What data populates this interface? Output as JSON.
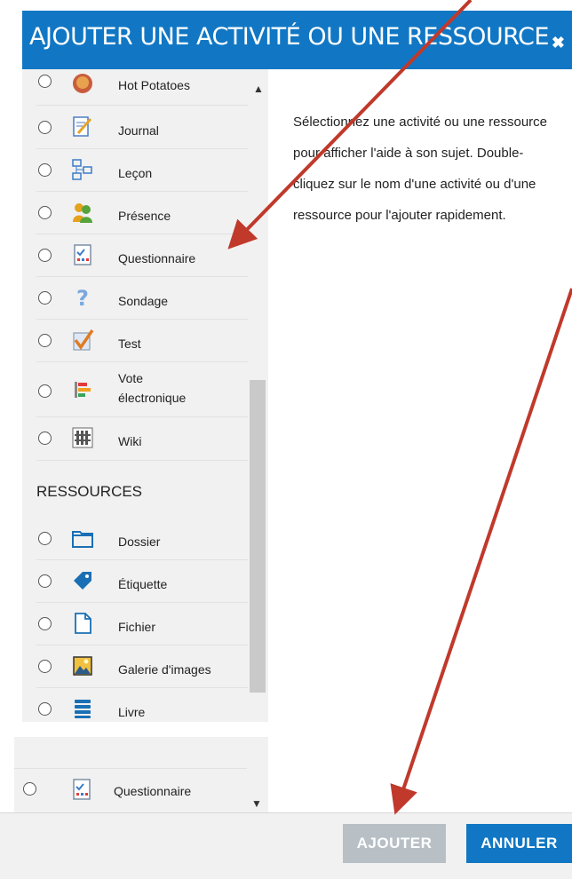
{
  "dialog": {
    "title": "AJOUTER UNE ACTIVITÉ OU UNE RESSOURCE",
    "close_symbol": "✖"
  },
  "activities": [
    {
      "label": "Hot Potatoes",
      "icon": "hot-potatoes-icon"
    },
    {
      "label": "Journal",
      "icon": "journal-icon"
    },
    {
      "label": "Leçon",
      "icon": "lesson-icon"
    },
    {
      "label": "Présence",
      "icon": "attendance-icon"
    },
    {
      "label": "Questionnaire",
      "icon": "questionnaire-icon"
    },
    {
      "label": "Sondage",
      "icon": "survey-icon"
    },
    {
      "label": "Test",
      "icon": "quiz-icon"
    },
    {
      "label": "Vote électronique",
      "label_line1": "Vote",
      "label_line2": "électronique",
      "icon": "choice-icon"
    },
    {
      "label": "Wiki",
      "icon": "wiki-icon"
    }
  ],
  "resources_title": "RESSOURCES",
  "resources": [
    {
      "label": "Dossier",
      "icon": "folder-icon"
    },
    {
      "label": "Étiquette",
      "icon": "label-icon"
    },
    {
      "label": "Fichier",
      "icon": "file-icon"
    },
    {
      "label": "Galerie d'images",
      "icon": "image-gallery-icon"
    },
    {
      "label": "Livre",
      "icon": "book-icon"
    }
  ],
  "lower_panel": {
    "item": {
      "label": "Questionnaire",
      "icon": "questionnaire-icon"
    }
  },
  "help_text": "Sélectionnez une activité ou une ressource pour afficher l'aide à son sujet. Double-cliquez sur le nom d'une activité ou d'une ressource pour l'ajouter rapidement.",
  "buttons": {
    "add": "AJOUTER",
    "cancel": "ANNULER"
  },
  "colors": {
    "header": "#1177c4",
    "annotation_arrow": "#c0392b",
    "disabled_button": "#b8c0c6"
  }
}
